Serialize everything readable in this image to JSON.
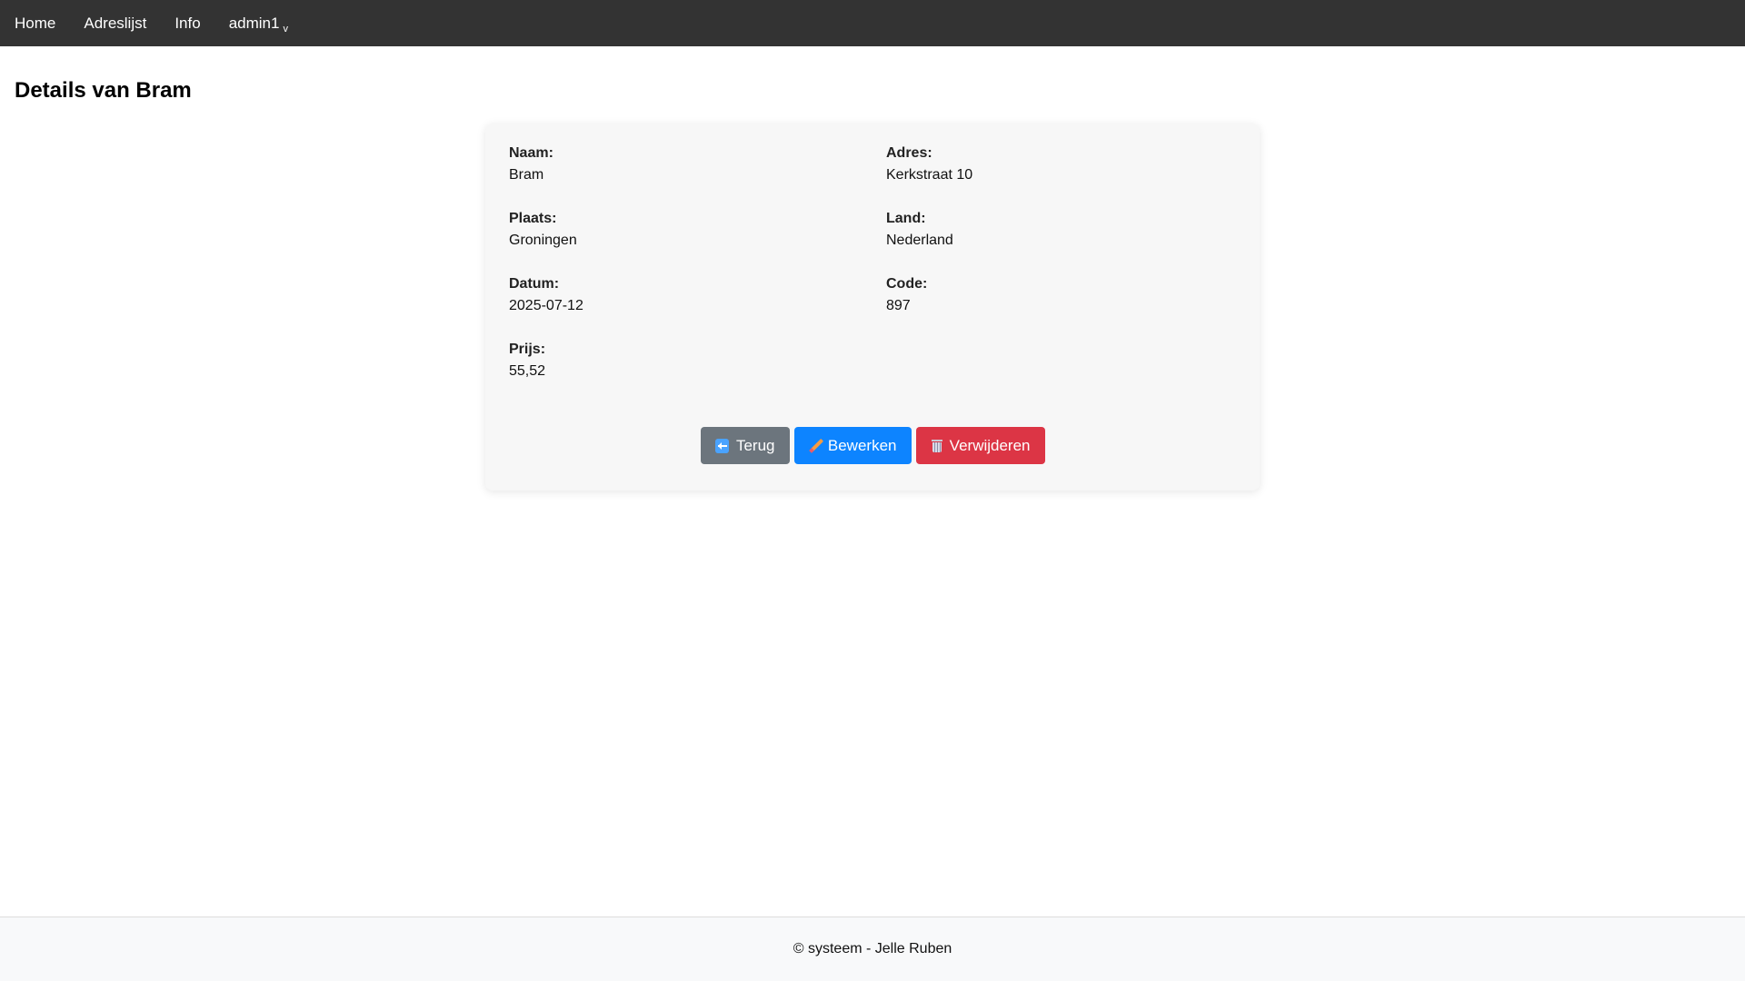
{
  "nav": {
    "items": [
      {
        "label": "Home"
      },
      {
        "label": "Adreslijst"
      },
      {
        "label": "Info"
      }
    ],
    "user": {
      "label": "admin1",
      "caret": "v"
    }
  },
  "page": {
    "title": "Details van Bram"
  },
  "details": {
    "naam": {
      "label": "Naam:",
      "value": "Bram"
    },
    "adres": {
      "label": "Adres:",
      "value": "Kerkstraat 10"
    },
    "plaats": {
      "label": "Plaats:",
      "value": "Groningen"
    },
    "land": {
      "label": "Land:",
      "value": "Nederland"
    },
    "datum": {
      "label": "Datum:",
      "value": "2025-07-12"
    },
    "code": {
      "label": "Code:",
      "value": "897"
    },
    "prijs": {
      "label": "Prijs:",
      "value": "55,52"
    }
  },
  "actions": {
    "back": {
      "label": "Terug",
      "icon": "back-arrow-icon",
      "color": "#6c757d"
    },
    "edit": {
      "label": "Bewerken",
      "icon": "pencil-icon",
      "color": "#0d84ff"
    },
    "delete": {
      "label": "Verwijderen",
      "icon": "trash-icon",
      "color": "#dc3545"
    }
  },
  "footer": {
    "text": "© systeem - Jelle Ruben"
  },
  "colors": {
    "navbar": "#333333",
    "card": "#f7f7f7",
    "footer": "#f8f9fa"
  }
}
